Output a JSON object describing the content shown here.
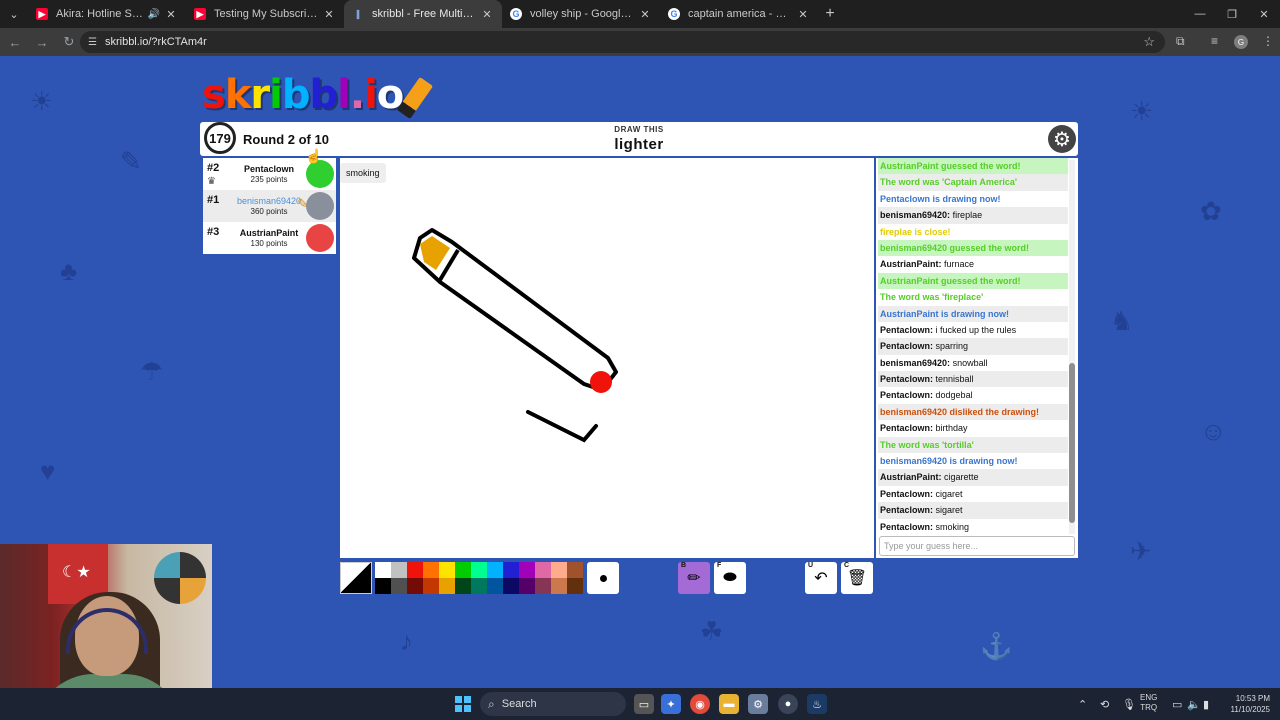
{
  "browser": {
    "tabs": [
      {
        "title": "Akira: Hotline Spikes (Death",
        "favicon": "youtube-icon",
        "audio": true
      },
      {
        "title": "Testing My Subscribers' Struggl",
        "favicon": "youtube-icon",
        "audio": false
      },
      {
        "title": "skribbl - Free Multiplayer Draw",
        "favicon": "skribbl-icon",
        "audio": false
      },
      {
        "title": "volley ship - Google Search",
        "favicon": "google-icon",
        "audio": false
      },
      {
        "title": "captain america - Google Search",
        "favicon": "google-icon",
        "audio": false
      }
    ],
    "active_tab": 2,
    "url": "skribbl.io/?rkCTAm4r",
    "profile_initial": "G"
  },
  "game": {
    "logo_text": "skribbl.io",
    "timer": "179",
    "round_label": "Round 2 of 10",
    "draw_this_label": "DRAW THIS",
    "word": "lighter",
    "players": [
      {
        "rank": "#2",
        "name": "Pentaclown",
        "points": "235 points",
        "is_self": false,
        "drawing": false,
        "crown": true,
        "avatar_color": "#2fcf2f"
      },
      {
        "rank": "#1",
        "name": "benisman69420",
        "points": "360 points",
        "is_self": true,
        "drawing": true,
        "crown": false,
        "avatar_color": "#8a8f9c"
      },
      {
        "rank": "#3",
        "name": "AustrianPaint",
        "points": "130 points",
        "is_self": false,
        "drawing": false,
        "crown": false,
        "avatar_color": "#e84444"
      }
    ],
    "hint_bubble": "smoking",
    "chat": [
      {
        "text": "AustrianPaint guessed the word!",
        "type": "green"
      },
      {
        "text": "The word was 'Captain America'",
        "type": "greentext"
      },
      {
        "text": "Pentaclown is drawing now!",
        "type": "blue"
      },
      {
        "user": "benisman69420:",
        "text": "fireplae",
        "type": "normal"
      },
      {
        "text": "fireplae is close!",
        "type": "yellow"
      },
      {
        "text": "benisman69420 guessed the word!",
        "type": "green"
      },
      {
        "user": "AustrianPaint:",
        "text": "furnace",
        "type": "normal"
      },
      {
        "text": "AustrianPaint guessed the word!",
        "type": "green"
      },
      {
        "text": "The word was 'fireplace'",
        "type": "greentext"
      },
      {
        "text": "AustrianPaint is drawing now!",
        "type": "blue"
      },
      {
        "user": "Pentaclown:",
        "text": "i fucked up the rules",
        "type": "normal"
      },
      {
        "user": "Pentaclown:",
        "text": "sparring",
        "type": "normal"
      },
      {
        "user": "benisman69420:",
        "text": "snowball",
        "type": "normal"
      },
      {
        "user": "Pentaclown:",
        "text": "tennisball",
        "type": "normal"
      },
      {
        "user": "Pentaclown:",
        "text": "dodgebal",
        "type": "normal"
      },
      {
        "text": "benisman69420 disliked the drawing!",
        "type": "red"
      },
      {
        "user": "Pentaclown:",
        "text": "birthday",
        "type": "normal"
      },
      {
        "text": "The word was 'tortilla'",
        "type": "greentext"
      },
      {
        "text": "benisman69420 is drawing now!",
        "type": "blue"
      },
      {
        "user": "AustrianPaint:",
        "text": "cigarette",
        "type": "normal"
      },
      {
        "user": "Pentaclown:",
        "text": "cigaret",
        "type": "normal"
      },
      {
        "user": "Pentaclown:",
        "text": "sigaret",
        "type": "normal"
      },
      {
        "user": "Pentaclown:",
        "text": "smoking",
        "type": "normal"
      }
    ],
    "guess_placeholder": "Type your guess here...",
    "palette": [
      "#ffffff",
      "#c1c1c1",
      "#ef130b",
      "#ff7100",
      "#ffe400",
      "#00cc00",
      "#00ff91",
      "#00b2ff",
      "#231fd3",
      "#a300ba",
      "#df69a7",
      "#ffac8e",
      "#a0522d",
      "#000000",
      "#505050",
      "#740b07",
      "#c23800",
      "#e8a200",
      "#004619",
      "#00785d",
      "#00569e",
      "#0e0865",
      "#550069",
      "#873554",
      "#cc774d",
      "#63300d"
    ],
    "tools": [
      {
        "key": "B",
        "name": "pencil",
        "selected": true
      },
      {
        "key": "F",
        "name": "fill",
        "selected": false
      },
      {
        "key": "U",
        "name": "undo",
        "selected": false
      },
      {
        "key": "C",
        "name": "clear",
        "selected": false
      }
    ]
  },
  "taskbar": {
    "search_label": "Search",
    "lang_top": "ENG",
    "lang_bottom": "TRQ",
    "time": "10:53 PM",
    "date": "11/10/2025"
  }
}
